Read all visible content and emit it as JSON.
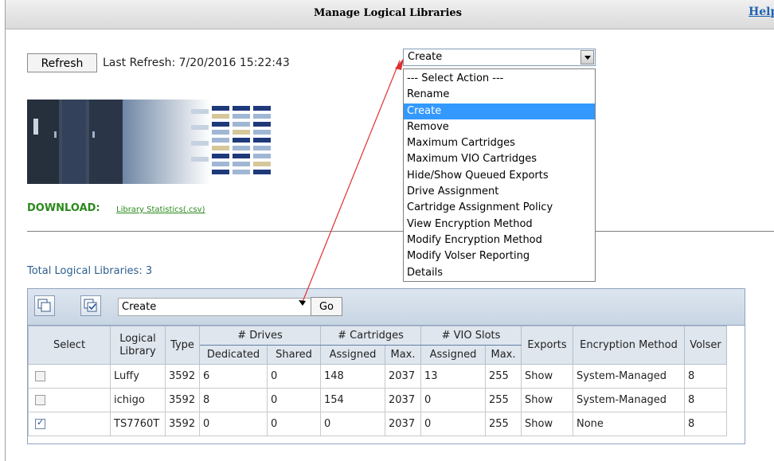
{
  "page": {
    "title": "Manage Logical Libraries",
    "help_label": "Help"
  },
  "refresh": {
    "button_label": "Refresh",
    "last_refresh": "Last Refresh: 7/20/2016 15:22:43"
  },
  "download": {
    "label": "DOWNLOAD:",
    "link": "Library Statistics(.csv)"
  },
  "action_dropdown": {
    "value": "Create",
    "options": [
      "--- Select Action ---",
      "Rename",
      "Create",
      "Remove",
      "Maximum Cartridges",
      "Maximum VIO Cartridges",
      "Hide/Show Queued Exports",
      "Drive Assignment",
      "Cartridge Assignment Policy",
      "View Encryption Method",
      "Modify Encryption Method",
      "Modify Volser Reporting",
      "Details"
    ],
    "selected_index": 2
  },
  "summary": {
    "total_libraries": "Total Logical Libraries: 3"
  },
  "table_toolbar": {
    "action_value": "Create",
    "go_label": "Go"
  },
  "table": {
    "headers": {
      "select": "Select",
      "logical_library": "Logical Library",
      "type": "Type",
      "drives": "# Drives",
      "dedicated": "Dedicated",
      "shared": "Shared",
      "cartridges": "# Cartridges",
      "assigned": "Assigned",
      "max": "Max.",
      "vio_slots": "# VIO Slots",
      "vio_assigned": "Assigned",
      "vio_max": "Max.",
      "exports": "Exports",
      "encryption": "Encryption Method",
      "volser": "Volser"
    },
    "rows": [
      {
        "checked": false,
        "name": "Luffy",
        "type": "3592",
        "dedicated": "6",
        "shared": "0",
        "cart_assigned": "148",
        "cart_max": "2037",
        "vio_assigned": "13",
        "vio_max": "255",
        "exports": "Show",
        "encryption": "System-Managed",
        "volser": "8"
      },
      {
        "checked": false,
        "name": "ichigo",
        "type": "3592",
        "dedicated": "8",
        "shared": "0",
        "cart_assigned": "154",
        "cart_max": "2037",
        "vio_assigned": "0",
        "vio_max": "255",
        "exports": "Show",
        "encryption": "System-Managed",
        "volser": "8"
      },
      {
        "checked": true,
        "name": "TS7760T",
        "type": "3592",
        "dedicated": "0",
        "shared": "0",
        "cart_assigned": "0",
        "cart_max": "2037",
        "vio_assigned": "0",
        "vio_max": "255",
        "exports": "Show",
        "encryption": "None",
        "volser": "8"
      }
    ]
  },
  "colors": {
    "download_green": "#2a8a1b",
    "link_blue": "#2262b3",
    "highlight": "#3399ff",
    "annotation_arrow": "#e03030"
  }
}
